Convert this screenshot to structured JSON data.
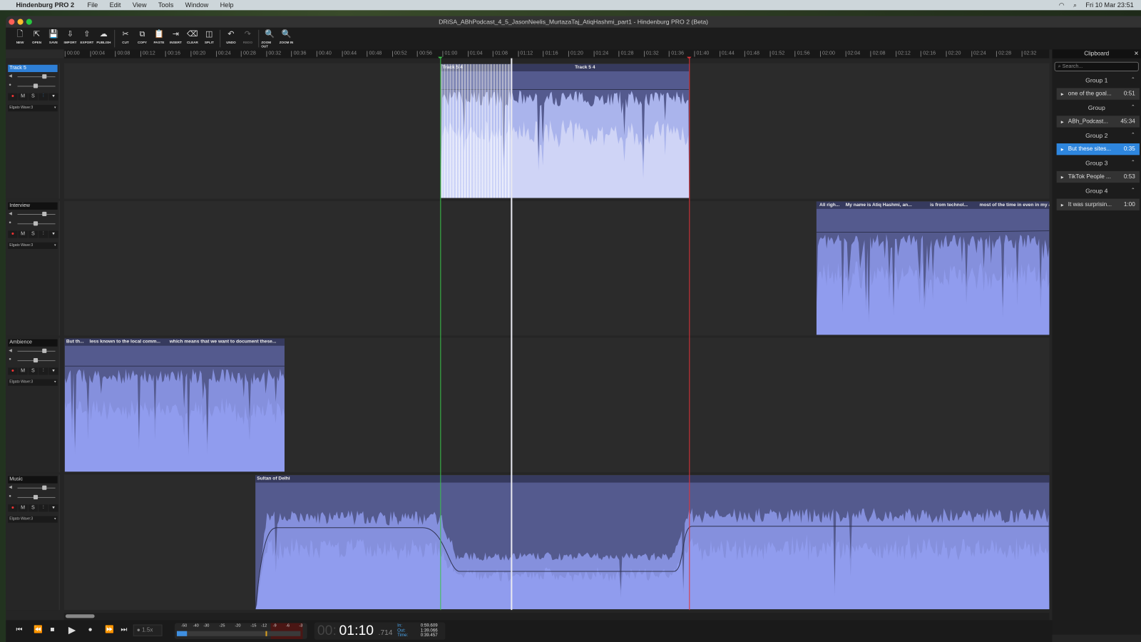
{
  "menubar": {
    "app": "Hindenburg PRO 2",
    "items": [
      "File",
      "Edit",
      "View",
      "Tools",
      "Window",
      "Help"
    ],
    "clock": "Fri 10 Mar  23:51"
  },
  "window": {
    "title": "DRiSA_ABhPodcast_4_5_JasonNeelis_MurtazaTaj_AtiqHashmi_part1 - Hindenburg PRO 2 (Beta)"
  },
  "toolbar": [
    {
      "label": "NEW",
      "icon": "new-file-icon",
      "glyph": "🗋"
    },
    {
      "label": "OPEN",
      "icon": "open-icon",
      "glyph": "⇱"
    },
    {
      "label": "SAVE",
      "icon": "save-icon",
      "glyph": "💾"
    },
    {
      "label": "IMPORT",
      "icon": "import-icon",
      "glyph": "⇩"
    },
    {
      "label": "EXPORT",
      "icon": "export-icon",
      "glyph": "⇧"
    },
    {
      "label": "PUBLISH",
      "icon": "cloud-upload-icon",
      "glyph": "☁"
    },
    {
      "label": "CUT",
      "icon": "scissors-icon",
      "glyph": "✂"
    },
    {
      "label": "COPY",
      "icon": "copy-icon",
      "glyph": "⧉"
    },
    {
      "label": "PASTE",
      "icon": "paste-icon",
      "glyph": "📋"
    },
    {
      "label": "INSERT",
      "icon": "insert-icon",
      "glyph": "⇥"
    },
    {
      "label": "CLEAR",
      "icon": "eraser-icon",
      "glyph": "⌫"
    },
    {
      "label": "SPLIT",
      "icon": "split-icon",
      "glyph": "◫"
    },
    {
      "label": "UNDO",
      "icon": "undo-icon",
      "glyph": "↶"
    },
    {
      "label": "REDO",
      "icon": "redo-icon",
      "glyph": "↷"
    },
    {
      "label": "ZOOM OUT",
      "icon": "zoom-out-icon",
      "glyph": "🔍"
    },
    {
      "label": "ZOOM IN",
      "icon": "zoom-in-icon",
      "glyph": "🔍"
    }
  ],
  "ruler": [
    "00:00",
    "00:04",
    "00:08",
    "00:12",
    "00:16",
    "00:20",
    "00:24",
    "00:28",
    "00:32",
    "00:36",
    "00:40",
    "00:44",
    "00:48",
    "00:52",
    "00:56",
    "01:00",
    "01:04",
    "01:08",
    "01:12",
    "01:16",
    "01:20",
    "01:24",
    "01:28",
    "01:32",
    "01:36",
    "01:40",
    "01:44",
    "01:48",
    "01:52",
    "01:56",
    "02:00",
    "02:04",
    "02:08",
    "02:12",
    "02:16",
    "02:20",
    "02:24",
    "02:28",
    "02:32"
  ],
  "tracks": [
    {
      "name": "Track 5",
      "selected": true,
      "device": "Elgato Wave:3",
      "buttons": [
        "M",
        "S"
      ],
      "clips": [
        {
          "labels": [
            "Track 5 4",
            "Track 5 4"
          ]
        }
      ]
    },
    {
      "name": "Interview",
      "selected": false,
      "device": "Elgato Wave:3",
      "buttons": [
        "M",
        "S"
      ],
      "clips": [
        {
          "labels": [
            "All righ...",
            "My name is Atiq Hashmi, an...",
            "is from technol...",
            "most of the time in even in my acade"
          ]
        }
      ]
    },
    {
      "name": "Ambience",
      "selected": false,
      "device": "Elgato Wave:3",
      "buttons": [
        "M",
        "S"
      ],
      "clips": [
        {
          "labels": [
            "But th...",
            "less known to the local comm...",
            "which means that we want to document these..."
          ]
        }
      ]
    },
    {
      "name": "Music",
      "selected": false,
      "device": "Elgato Wave:3",
      "buttons": [
        "M",
        "S"
      ],
      "clips": [
        {
          "labels": [
            "Sultan of Delhi"
          ]
        }
      ]
    }
  ],
  "clipboard": {
    "title": "Clipboard",
    "search_placeholder": "Search...",
    "groups": [
      {
        "name": "Group 1",
        "item": "one of the goal...",
        "duration": "0:51",
        "selected": false
      },
      {
        "name": "Group",
        "item": "ABh_Podcast...",
        "duration": "45:34",
        "selected": false
      },
      {
        "name": "Group 2",
        "item": "But these sites...",
        "duration": "0:35",
        "selected": true
      },
      {
        "name": "Group 3",
        "item": "TikTok People ...",
        "duration": "0:53",
        "selected": false
      },
      {
        "name": "Group 4",
        "item": "It was surprisin...",
        "duration": "1:00",
        "selected": false
      }
    ]
  },
  "transport": {
    "speed": "1.5x",
    "meter_labels": [
      "-50",
      "-40",
      "-30",
      "-25",
      "-20",
      "-15",
      "-12",
      "-9",
      "-6",
      "-3"
    ],
    "time_dim": "00:",
    "time_main": "01:10",
    "time_ms": ".714",
    "in_label": "In:",
    "in_value": "0:59.609",
    "out_label": "Out:",
    "out_value": "1:39.066",
    "time_label": "Time:",
    "time_value": "0:39.457"
  },
  "colors": {
    "accent": "#2e86de",
    "clip": "#545a8e",
    "wave": "#8f9bec",
    "in_marker": "#3ac24a",
    "out_marker": "#e0333a"
  }
}
